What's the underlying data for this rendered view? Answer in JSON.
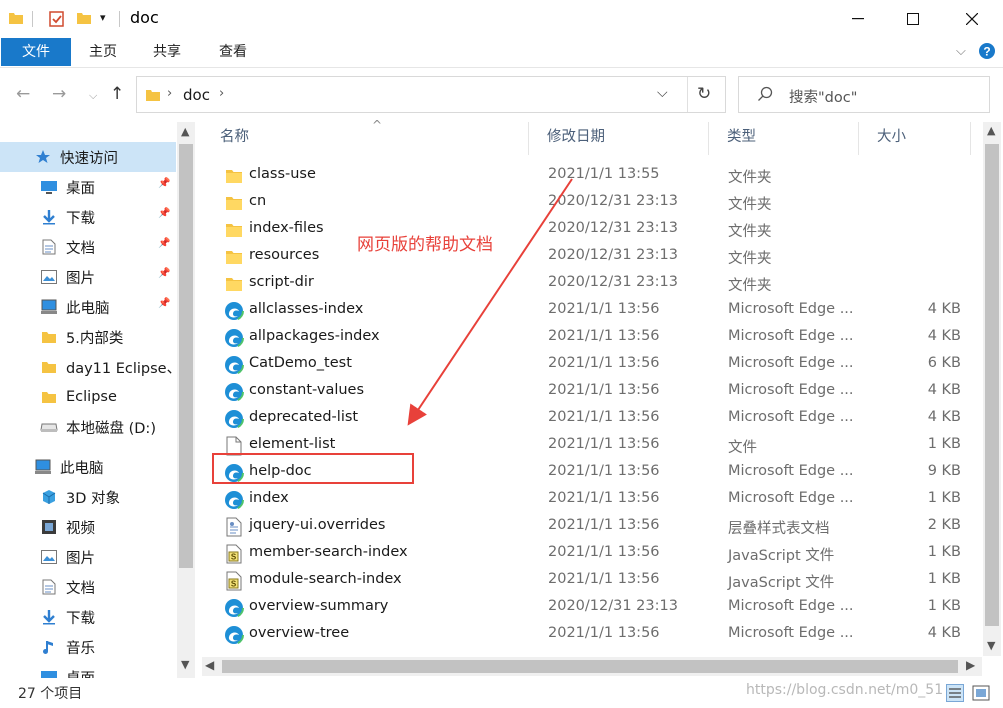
{
  "window": {
    "title": "doc"
  },
  "ribbon": {
    "tabs": [
      "文件",
      "主页",
      "共享",
      "查看"
    ]
  },
  "address": {
    "path": [
      "doc"
    ],
    "search_placeholder": "搜索\"doc\""
  },
  "nav": {
    "quick_access": "快速访问",
    "items": [
      {
        "label": "快速访问",
        "icon": "star-icon",
        "pinned": false
      },
      {
        "label": "桌面",
        "icon": "desktop-icon",
        "pinned": true
      },
      {
        "label": "下载",
        "icon": "download-icon",
        "pinned": true
      },
      {
        "label": "文档",
        "icon": "document-icon",
        "pinned": true
      },
      {
        "label": "图片",
        "icon": "picture-icon",
        "pinned": true
      },
      {
        "label": "此电脑",
        "icon": "computer-icon",
        "pinned": true
      },
      {
        "label": "5.内部类",
        "icon": "folder-icon",
        "pinned": false
      },
      {
        "label": "day11 Eclipse、",
        "icon": "folder-icon",
        "pinned": false
      },
      {
        "label": "Eclipse",
        "icon": "folder-icon",
        "pinned": false
      },
      {
        "label": "本地磁盘 (D:)",
        "icon": "drive-icon",
        "pinned": false
      },
      {
        "label": "此电脑",
        "icon": "computer-icon",
        "pinned": false
      },
      {
        "label": "3D 对象",
        "icon": "cube-icon",
        "pinned": false
      },
      {
        "label": "视频",
        "icon": "video-icon",
        "pinned": false
      },
      {
        "label": "图片",
        "icon": "picture-icon",
        "pinned": false
      },
      {
        "label": "文档",
        "icon": "document-icon",
        "pinned": false
      },
      {
        "label": "下载",
        "icon": "download-icon",
        "pinned": false
      },
      {
        "label": "音乐",
        "icon": "music-icon",
        "pinned": false
      },
      {
        "label": "桌面",
        "icon": "desktop-icon",
        "pinned": false
      }
    ]
  },
  "columns": [
    "名称",
    "修改日期",
    "类型",
    "大小"
  ],
  "files": [
    {
      "name": "class-use",
      "date": "2021/1/1 13:55",
      "type": "文件夹",
      "size": "",
      "icon": "folder-icon"
    },
    {
      "name": "cn",
      "date": "2020/12/31 23:13",
      "type": "文件夹",
      "size": "",
      "icon": "folder-icon"
    },
    {
      "name": "index-files",
      "date": "2020/12/31 23:13",
      "type": "文件夹",
      "size": "",
      "icon": "folder-icon"
    },
    {
      "name": "resources",
      "date": "2020/12/31 23:13",
      "type": "文件夹",
      "size": "",
      "icon": "folder-icon"
    },
    {
      "name": "script-dir",
      "date": "2020/12/31 23:13",
      "type": "文件夹",
      "size": "",
      "icon": "folder-icon"
    },
    {
      "name": "allclasses-index",
      "date": "2021/1/1 13:56",
      "type": "Microsoft Edge ...",
      "size": "4 KB",
      "icon": "edge-icon"
    },
    {
      "name": "allpackages-index",
      "date": "2021/1/1 13:56",
      "type": "Microsoft Edge ...",
      "size": "4 KB",
      "icon": "edge-icon"
    },
    {
      "name": "CatDemo_test",
      "date": "2021/1/1 13:56",
      "type": "Microsoft Edge ...",
      "size": "6 KB",
      "icon": "edge-icon"
    },
    {
      "name": "constant-values",
      "date": "2021/1/1 13:56",
      "type": "Microsoft Edge ...",
      "size": "4 KB",
      "icon": "edge-icon"
    },
    {
      "name": "deprecated-list",
      "date": "2021/1/1 13:56",
      "type": "Microsoft Edge ...",
      "size": "4 KB",
      "icon": "edge-icon"
    },
    {
      "name": "element-list",
      "date": "2021/1/1 13:56",
      "type": "文件",
      "size": "1 KB",
      "icon": "file-icon"
    },
    {
      "name": "help-doc",
      "date": "2021/1/1 13:56",
      "type": "Microsoft Edge ...",
      "size": "9 KB",
      "icon": "edge-icon"
    },
    {
      "name": "index",
      "date": "2021/1/1 13:56",
      "type": "Microsoft Edge ...",
      "size": "1 KB",
      "icon": "edge-icon"
    },
    {
      "name": "jquery-ui.overrides",
      "date": "2021/1/1 13:56",
      "type": "层叠样式表文档",
      "size": "2 KB",
      "icon": "css-file-icon"
    },
    {
      "name": "member-search-index",
      "date": "2021/1/1 13:56",
      "type": "JavaScript 文件",
      "size": "1 KB",
      "icon": "script-file-icon"
    },
    {
      "name": "module-search-index",
      "date": "2021/1/1 13:56",
      "type": "JavaScript 文件",
      "size": "1 KB",
      "icon": "script-file-icon"
    },
    {
      "name": "overview-summary",
      "date": "2020/12/31 23:13",
      "type": "Microsoft Edge ...",
      "size": "1 KB",
      "icon": "edge-icon"
    },
    {
      "name": "overview-tree",
      "date": "2021/1/1 13:56",
      "type": "Microsoft Edge ...",
      "size": "4 KB",
      "icon": "edge-icon"
    }
  ],
  "status": {
    "item_count": "27 个项目"
  },
  "annotation": {
    "text": "网页版的帮助文档",
    "color": "#e8413a"
  },
  "watermark": "https://blog.csdn.net/m0_51",
  "colors": {
    "accent": "#1979ca",
    "nav_selected": "#cce4f7",
    "folder": "#f5c342",
    "edge": "#1e8fd6"
  }
}
